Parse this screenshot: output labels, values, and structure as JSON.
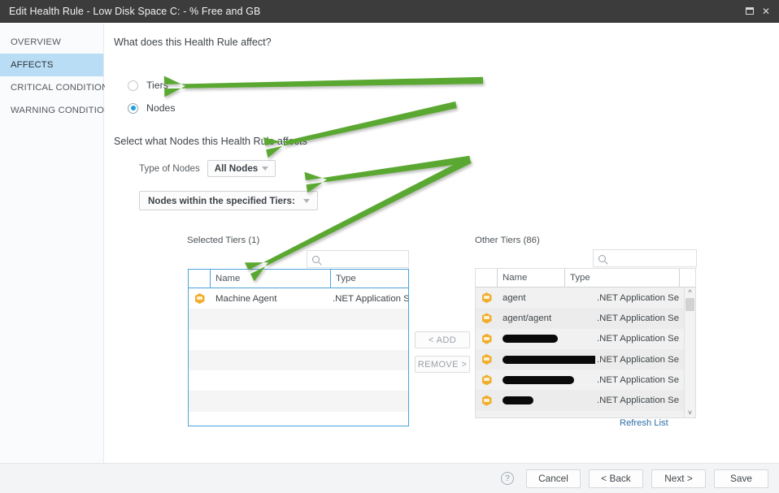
{
  "window": {
    "title": "Edit Health Rule - Low Disk Space C: - % Free and GB",
    "restore_label": "❐",
    "close_label": "✕"
  },
  "sidebar": {
    "items": [
      {
        "label": "OVERVIEW",
        "active": false
      },
      {
        "label": "AFFECTS",
        "active": true
      },
      {
        "label": "CRITICAL CONDITION",
        "active": false
      },
      {
        "label": "WARNING CONDITION",
        "active": false
      }
    ]
  },
  "main": {
    "question": "What does this Health Rule affect?",
    "radios": [
      {
        "label": "Tiers",
        "checked": false
      },
      {
        "label": "Nodes",
        "checked": true
      }
    ],
    "sub_label": "Select what Nodes this Health Rule affects",
    "type_of_nodes_label": "Type of Nodes",
    "type_of_nodes_value": "All Nodes",
    "scope_value": "Nodes within the specified Tiers:"
  },
  "dual_list": {
    "left_title": "Selected Tiers (1)",
    "right_title": "Other Tiers (86)",
    "search_placeholder": "",
    "columns": [
      "",
      "Name",
      "Type"
    ],
    "add_label": "< ADD",
    "remove_label": "REMOVE >",
    "refresh_label": "Refresh List",
    "selected_rows": [
      {
        "name": "Machine Agent",
        "type": ".NET Application Se",
        "redacted": false
      }
    ],
    "other_rows": [
      {
        "name": "agent",
        "type": ".NET Application Se",
        "redacted": false
      },
      {
        "name": "agent/agent",
        "type": ".NET Application Se",
        "redacted": false
      },
      {
        "name": "",
        "type": ".NET Application Se",
        "redacted": true,
        "redact_width": 68
      },
      {
        "name": "",
        "type": ".NET Application Se",
        "redacted": true,
        "redact_width": 130
      },
      {
        "name": "",
        "type": ".NET Application Se",
        "redacted": true,
        "redact_width": 88
      },
      {
        "name": "",
        "type": ".NET Application Se",
        "redacted": true,
        "redact_width": 38
      }
    ]
  },
  "footer": {
    "help_label": "?",
    "buttons": [
      "Cancel",
      "< Back",
      "Next >",
      "Save"
    ]
  },
  "annotations": {
    "color": "#5aa832",
    "arrow_count": 4
  }
}
